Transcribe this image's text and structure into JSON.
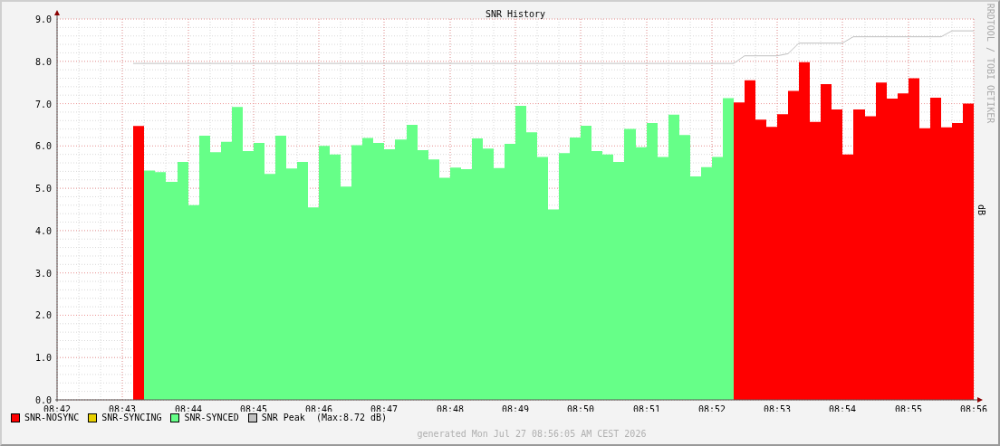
{
  "chart": {
    "credit": "RRDTOOL / TOBI OETIKER",
    "chart_data": {
      "type": "area",
      "title": "SNR History",
      "legend": true,
      "grid": true,
      "ylabel": "dB",
      "ylim": [
        0,
        9
      ],
      "yticks": [
        {
          "value": 0,
          "label": "0.0"
        },
        {
          "value": 1,
          "label": "1.0"
        },
        {
          "value": 2,
          "label": "2.0"
        },
        {
          "value": 3,
          "label": "3.0"
        },
        {
          "value": 4,
          "label": "4.0"
        },
        {
          "value": 5,
          "label": "5.0"
        },
        {
          "value": 6,
          "label": "6.0"
        },
        {
          "value": 7,
          "label": "7.0"
        },
        {
          "value": 8,
          "label": "8.0"
        },
        {
          "value": 9,
          "label": "9.0"
        }
      ],
      "categories": [
        "08:42",
        null,
        null,
        null,
        null,
        null,
        "08:43",
        null,
        null,
        null,
        null,
        null,
        "08:44",
        null,
        null,
        null,
        null,
        null,
        "08:45",
        null,
        null,
        null,
        null,
        null,
        "08:46",
        null,
        null,
        null,
        null,
        null,
        "08:47",
        null,
        null,
        null,
        null,
        null,
        "08:48",
        null,
        null,
        null,
        null,
        null,
        "08:49",
        null,
        null,
        null,
        null,
        null,
        "08:50",
        null,
        null,
        null,
        null,
        null,
        "08:51",
        null,
        null,
        null,
        null,
        null,
        "08:52",
        null,
        null,
        null,
        null,
        null,
        "08:53",
        null,
        null,
        null,
        null,
        null,
        "08:54",
        null,
        null,
        null,
        null,
        null,
        "08:55",
        null,
        null,
        null,
        null,
        null,
        "08:56"
      ],
      "series": [
        {
          "name": "SNR-NOSYNC",
          "type": "area",
          "color": "#ff0000",
          "values": [
            null,
            null,
            null,
            null,
            null,
            null,
            null,
            6.47,
            6.47,
            null,
            null,
            null,
            null,
            null,
            null,
            null,
            null,
            null,
            null,
            null,
            null,
            null,
            null,
            null,
            null,
            null,
            null,
            null,
            null,
            null,
            null,
            null,
            null,
            null,
            null,
            null,
            null,
            null,
            null,
            null,
            null,
            null,
            null,
            null,
            null,
            null,
            null,
            null,
            null,
            null,
            null,
            null,
            null,
            null,
            null,
            null,
            null,
            null,
            null,
            null,
            null,
            null,
            7.03,
            7.55,
            6.62,
            6.45,
            6.75,
            7.3,
            7.98,
            6.57,
            7.46,
            6.86,
            5.8,
            6.86,
            6.7,
            7.5,
            7.12,
            7.24,
            7.6,
            6.42,
            7.14,
            6.44,
            6.54,
            7.0,
            7.0
          ]
        },
        {
          "name": "SNR-SYNCING",
          "type": "area",
          "color": "#e8d000",
          "values": [
            null,
            null,
            null,
            null,
            null,
            null,
            null,
            null,
            null,
            null,
            null,
            null,
            null,
            null,
            null,
            null,
            null,
            null,
            null,
            null,
            null,
            null,
            null,
            null,
            null,
            null,
            null,
            null,
            null,
            null,
            null,
            null,
            null,
            null,
            null,
            null,
            null,
            null,
            null,
            null,
            null,
            null,
            null,
            null,
            null,
            null,
            null,
            null,
            null,
            null,
            null,
            null,
            null,
            null,
            null,
            null,
            null,
            null,
            null,
            null,
            null,
            null,
            null,
            null,
            null,
            null,
            null,
            null,
            null,
            null,
            null,
            null,
            null,
            null,
            null,
            null,
            null,
            null,
            null,
            null,
            null,
            null,
            null,
            null,
            null
          ]
        },
        {
          "name": "SNR-SYNCED",
          "type": "area",
          "color": "#66ff88",
          "values": [
            null,
            null,
            null,
            null,
            null,
            null,
            null,
            null,
            5.42,
            5.38,
            5.15,
            5.62,
            4.6,
            6.24,
            5.85,
            6.1,
            6.92,
            5.88,
            6.07,
            5.34,
            6.24,
            5.47,
            5.62,
            4.55,
            6.0,
            5.8,
            5.04,
            6.02,
            6.19,
            6.07,
            5.92,
            6.15,
            6.5,
            5.9,
            5.68,
            5.25,
            5.49,
            5.45,
            6.18,
            5.94,
            5.48,
            6.05,
            6.95,
            6.32,
            5.74,
            4.5,
            5.83,
            6.2,
            6.48,
            5.88,
            5.8,
            5.62,
            6.4,
            5.97,
            6.54,
            5.74,
            6.74,
            6.26,
            5.28,
            5.5,
            5.74,
            7.13,
            7.13,
            null,
            null,
            null,
            null,
            null,
            null,
            null,
            null,
            null,
            null,
            null,
            null,
            null,
            null,
            null,
            null,
            null,
            null,
            null,
            null,
            null,
            null
          ]
        },
        {
          "name": "SNR Peak  (Max:8.72 dB)",
          "type": "line",
          "color": "#c0c0c0",
          "values": [
            null,
            null,
            null,
            null,
            null,
            null,
            null,
            7.95,
            7.95,
            7.95,
            7.95,
            7.95,
            7.95,
            7.95,
            7.95,
            7.95,
            7.95,
            7.95,
            7.95,
            7.95,
            7.95,
            7.95,
            7.95,
            7.95,
            7.95,
            7.95,
            7.95,
            7.95,
            7.95,
            7.95,
            7.95,
            7.95,
            7.95,
            7.95,
            7.95,
            7.95,
            7.95,
            7.95,
            7.95,
            7.95,
            7.95,
            7.95,
            7.95,
            7.95,
            7.95,
            7.95,
            7.95,
            7.95,
            7.95,
            7.95,
            7.95,
            7.95,
            7.95,
            7.95,
            7.95,
            7.95,
            7.95,
            7.95,
            7.95,
            7.95,
            7.95,
            7.95,
            7.95,
            8.13,
            8.13,
            8.13,
            8.13,
            8.18,
            8.43,
            8.43,
            8.43,
            8.43,
            8.43,
            8.58,
            8.58,
            8.58,
            8.58,
            8.58,
            8.58,
            8.58,
            8.58,
            8.58,
            8.72,
            8.72,
            8.72
          ]
        }
      ]
    }
  },
  "footer": "generated Mon Jul 27 08:56:05 AM CEST 2026"
}
